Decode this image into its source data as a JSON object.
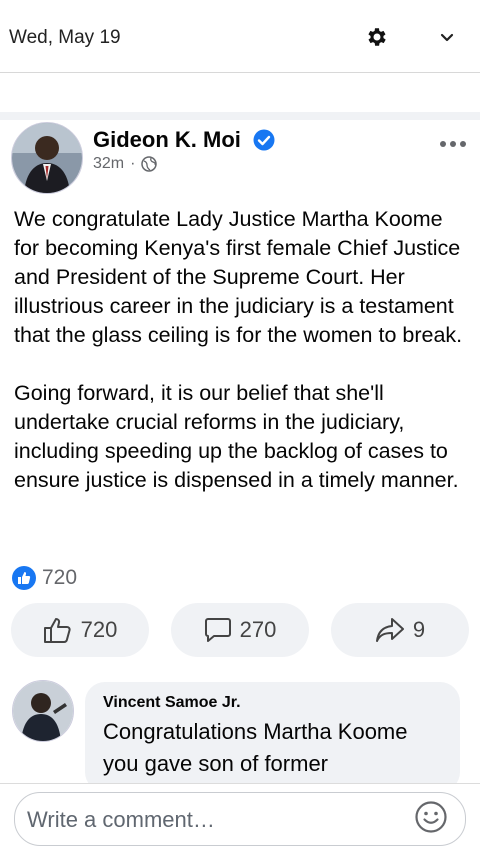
{
  "status": {
    "date": "Wed, May 19"
  },
  "icons": {
    "notif1": "chat-head-icon",
    "notif2": "whatsapp-icon",
    "notif3": "image-icon",
    "settings": "gear-icon",
    "expand": "chevron-down-icon"
  },
  "post": {
    "author": "Gideon K. Moi",
    "time": "32m",
    "paragraphs": [
      "We congratulate Lady Justice Martha Koome for becoming Kenya's first female Chief Justice and President of the Supreme Court. Her illustrious career in the judiciary is a testament that the glass ceiling is for the women to break.",
      "Going forward, it is our belief that she'll undertake crucial reforms in the judiciary, including speeding up the backlog of cases to ensure justice is dispensed in a timely manner."
    ],
    "reaction_count": "720"
  },
  "actions": {
    "like_count": "720",
    "comment_count": "270",
    "share_count": "9"
  },
  "comment": {
    "author": "Vincent Samoe Jr.",
    "text": "Congratulations Martha Koome you gave son of former"
  },
  "composer": {
    "placeholder": "Write a comment…"
  },
  "colors": {
    "accent": "#1877f2",
    "whatsapp": "#25a244",
    "pill_bg": "#f0f2f5"
  }
}
